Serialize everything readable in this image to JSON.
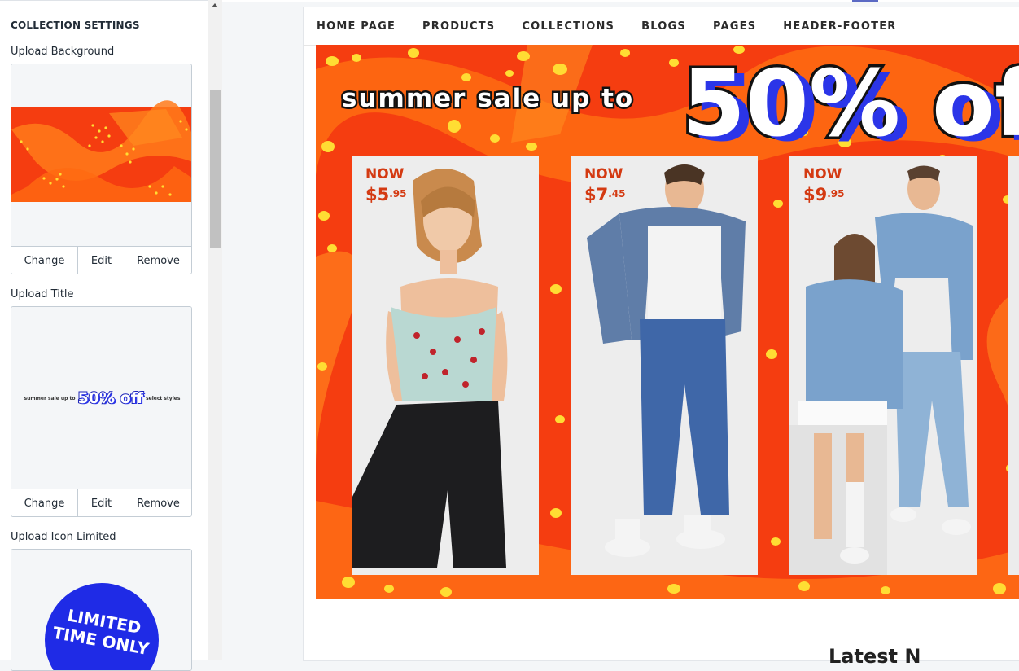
{
  "sidebar": {
    "heading": "COLLECTION SETTINGS",
    "fields": [
      {
        "label": "Upload Background",
        "actions": [
          "Change",
          "Edit",
          "Remove"
        ]
      },
      {
        "label": "Upload Title",
        "preview_small": "summer sale up to",
        "preview_big": "50% off",
        "preview_tail": "select styles",
        "actions": [
          "Change",
          "Edit",
          "Remove"
        ]
      },
      {
        "label": "Upload Icon Limited",
        "preview_text_1": "LIMITED",
        "preview_text_2": "TIME ONLY"
      }
    ]
  },
  "nav": {
    "items": [
      "HOME PAGE",
      "PRODUCTS",
      "COLLECTIONS",
      "BLOGS",
      "PAGES",
      "HEADER-FOOTER"
    ]
  },
  "banner": {
    "headline_small": "summer sale up to",
    "headline_big": "50% of",
    "cards": [
      {
        "now": "NOW",
        "price": "$5",
        "cents": ".95"
      },
      {
        "now": "NOW",
        "price": "$7",
        "cents": ".45"
      },
      {
        "now": "NOW",
        "price": "$9",
        "cents": ".95"
      }
    ]
  },
  "below_text": "Latest N",
  "colors": {
    "banner_orange": "#f53d10",
    "accent_yellow": "#ffdd33",
    "headline_shadow": "#2b35e8",
    "price_red": "#d43a12",
    "limited_badge": "#1f2be6"
  }
}
